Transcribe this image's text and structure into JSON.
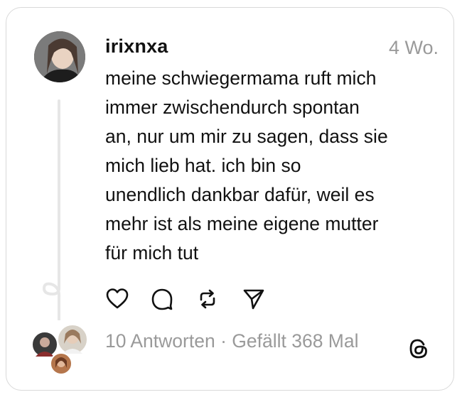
{
  "post": {
    "username": "irixnxa",
    "timestamp": "4 Wo.",
    "text": "meine schwiegermama ruft mich\nimmer zwischendurch spontan\nan, nur um mir zu sagen, dass sie\nmich lieb hat. ich bin so\nunendlich dankbar dafür, weil es\nmehr ist als meine eigene mutter\nfür mich tut",
    "replies_label": "10 Antworten",
    "separator": " · ",
    "likes_label": "Gefällt 368 Mal"
  },
  "icons": {
    "like": "heart-icon",
    "comment": "comment-icon",
    "repost": "repost-icon",
    "share": "send-icon",
    "brand": "threads-logo-icon"
  },
  "colors": {
    "text": "#111111",
    "muted": "#9a9a9a",
    "border": "#d9d9d9",
    "thread_line": "#e6e6e6"
  }
}
